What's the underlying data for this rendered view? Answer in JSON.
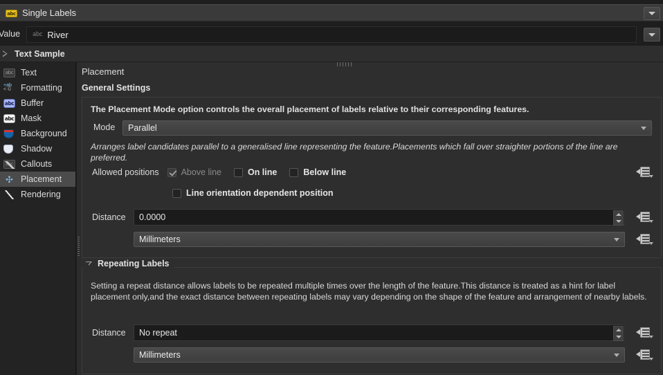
{
  "header": {
    "icon": "label-abc-icon",
    "title": "Single Labels",
    "dropdown_arrow": "chevron-down-icon"
  },
  "value_row": {
    "label": "Value",
    "field_prefix_icon": "abc",
    "value": "River",
    "dropdown_arrow": "chevron-down-icon"
  },
  "text_sample": {
    "expander": "triangle-right-icon",
    "title": "Text Sample"
  },
  "sidebar": {
    "items": [
      {
        "label": "Text",
        "icon": "text-icon",
        "active": false
      },
      {
        "label": "Formatting",
        "icon": "formatting-icon",
        "active": false
      },
      {
        "label": "Buffer",
        "icon": "buffer-icon",
        "active": false
      },
      {
        "label": "Mask",
        "icon": "mask-icon",
        "active": false
      },
      {
        "label": "Background",
        "icon": "background-icon",
        "active": false
      },
      {
        "label": "Shadow",
        "icon": "shadow-icon",
        "active": false
      },
      {
        "label": "Callouts",
        "icon": "callouts-icon",
        "active": false
      },
      {
        "label": "Placement",
        "icon": "placement-icon",
        "active": true
      },
      {
        "label": "Rendering",
        "icon": "rendering-icon",
        "active": false
      }
    ]
  },
  "panel": {
    "title": "Placement",
    "general": {
      "group_title": "General Settings",
      "hint": "The Placement Mode option controls the overall placement of labels relative to their corresponding features.",
      "mode_label": "Mode",
      "mode_value": "Parallel",
      "mode_description": "Arranges label candidates parallel to a generalised line representing the feature.Placements which fall over straighter portions of the line are preferred.",
      "allowed_positions_label": "Allowed positions",
      "checkboxes": [
        {
          "label": "Above line",
          "checked": true,
          "disabled": true
        },
        {
          "label": "On line",
          "checked": false,
          "disabled": false
        },
        {
          "label": "Below line",
          "checked": false,
          "disabled": false
        }
      ],
      "line_orientation": {
        "label": "Line orientation dependent position",
        "checked": false
      },
      "distance_label": "Distance",
      "distance_value": "0.0000",
      "units_value": "Millimeters",
      "override_icon": "data-defined-override-icon"
    },
    "repeating": {
      "group_title": "Repeating Labels",
      "collapse_icon": "triangle-down-icon",
      "description": "Setting a repeat distance allows labels to be repeated multiple times over the length of the feature.This distance is treated as a hint for label placement only,and the exact distance between repeating labels may vary depending on the shape of the feature and arrangement of nearby labels.",
      "distance_label": "Distance",
      "distance_value": "No repeat",
      "units_value": "Millimeters",
      "override_icon": "data-defined-override-icon"
    }
  },
  "colors": {
    "window_bg": "#1e1e1e",
    "panel_bg": "#2e2e2e",
    "sidebar_bg": "#232323",
    "accent_label_yellow": "#e8c020",
    "selection": "#4b4b4b"
  }
}
